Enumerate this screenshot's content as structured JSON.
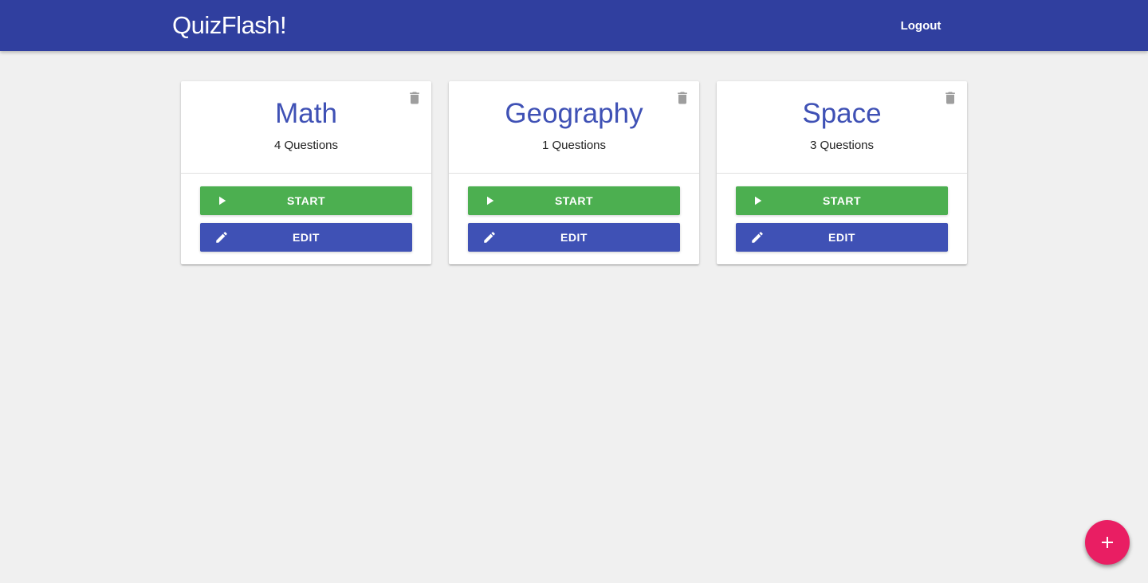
{
  "app": {
    "title": "QuizFlash!",
    "logout_label": "Logout"
  },
  "quizzes": [
    {
      "title": "Math",
      "questions": "4 Questions",
      "start_label": "START",
      "edit_label": "EDIT"
    },
    {
      "title": "Geography",
      "questions": "1 Questions",
      "start_label": "START",
      "edit_label": "EDIT"
    },
    {
      "title": "Space",
      "questions": "3 Questions",
      "start_label": "START",
      "edit_label": "EDIT"
    }
  ],
  "icons": {
    "delete": "trash-icon",
    "start": "play-icon",
    "edit": "pencil-icon",
    "add": "plus-icon"
  },
  "colors": {
    "appbar": "#303f9f",
    "primary": "#3f51b5",
    "start": "#4caf50",
    "fab": "#e91e63",
    "background": "#f0f0f0"
  }
}
